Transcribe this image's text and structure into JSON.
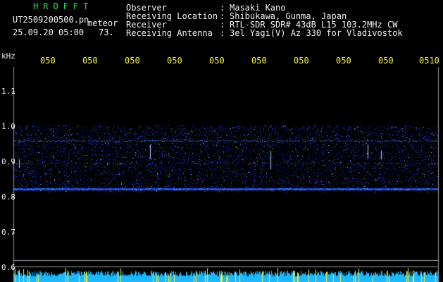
{
  "header": {
    "title": "HROFFT",
    "filename": "UT2509200500.pn",
    "mode": "meteor",
    "datetime": "25.09.20 05:00",
    "count": "73.",
    "info": [
      {
        "label": "Observer",
        "value": "Masaki Kano"
      },
      {
        "label": "Receiving Location",
        "value": "Shibukawa, Gunma, Japan"
      },
      {
        "label": "Receiver",
        "value": "RTL-SDR SDR# 43dB L15 103.2MHz CW"
      },
      {
        "label": "Receiving Antenna",
        "value": "3el Yagi(V) Az 330 for Vladivostok"
      }
    ]
  },
  "axis": {
    "unit": "kHz",
    "y_ticks": [
      "1.1",
      "1.0",
      "0.9",
      "0.8",
      "0.7",
      "0.6"
    ],
    "time_labels": [
      "050",
      "050",
      "050",
      "050",
      "050",
      "050",
      "050",
      "050",
      "050",
      "0510"
    ]
  },
  "colors": {
    "title_green": "#2fe04a",
    "label_white": "#f2f2f2",
    "time_yellow": "#f2f23a",
    "signal_blue": "#1e3cff",
    "echo_cyan": "#40e0ff"
  }
}
